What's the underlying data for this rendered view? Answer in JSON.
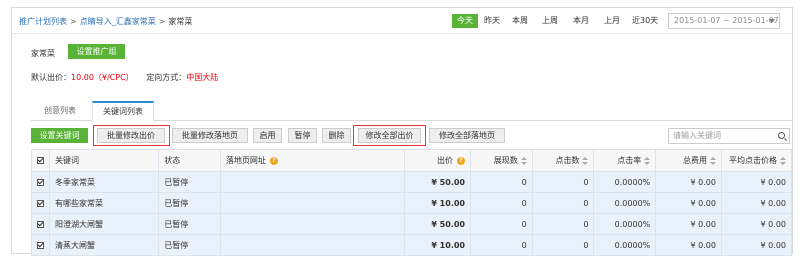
{
  "breadcrumb": {
    "items": [
      "推广计划列表",
      "点睛导入_汇鑫家常菜",
      "家常菜"
    ],
    "separator": ">"
  },
  "date_ranges": [
    "今天",
    "昨天",
    "本周",
    "上周",
    "本月",
    "上月",
    "近30天"
  ],
  "date_range_active": "今天",
  "date_picker": {
    "value": "2015-01-07 ~ 2015-01-07"
  },
  "group": {
    "name": "家常菜",
    "settings_button": "设置推广组"
  },
  "bid": {
    "label": "默认出价：",
    "value": "10.00（¥/CPC）",
    "targeting_label": "定向方式：",
    "targeting_value": "中国大陆"
  },
  "tabs": [
    {
      "label": "创意列表",
      "active": false
    },
    {
      "label": "关键词列表",
      "active": true
    }
  ],
  "toolbar": {
    "set_keywords": "设置关键词",
    "batch_bid": "批量修改出价",
    "batch_landing": "批量修改落地页",
    "enable": "启用",
    "pause": "暂停",
    "delete": "删除",
    "edit_all_bids": "修改全部出价",
    "edit_all_landing": "修改全部落地页"
  },
  "search": {
    "placeholder": "请输入关键词"
  },
  "table": {
    "headers": [
      "关键词",
      "状态",
      "落地页网址",
      "出价",
      "展现数",
      "点击数",
      "点击率",
      "总费用",
      "平均点击价格"
    ],
    "rows": [
      {
        "keyword": "冬季家常菜",
        "status": "已暂停",
        "url": "",
        "bid": "¥ 50.00",
        "impressions": "0",
        "clicks": "0",
        "ctr": "0.0000%",
        "cost": "¥ 0.00",
        "avg_cpc": "¥ 0.00"
      },
      {
        "keyword": "有哪些家常菜",
        "status": "已暂停",
        "url": "",
        "bid": "¥ 10.00",
        "impressions": "0",
        "clicks": "0",
        "ctr": "0.0000%",
        "cost": "¥ 0.00",
        "avg_cpc": "¥ 0.00"
      },
      {
        "keyword": "阳澄湖大闸蟹",
        "status": "已暂停",
        "url": "",
        "bid": "¥ 50.00",
        "impressions": "0",
        "clicks": "0",
        "ctr": "0.0000%",
        "cost": "¥ 0.00",
        "avg_cpc": "¥ 0.00"
      },
      {
        "keyword": "清蒸大闸蟹",
        "status": "已暂停",
        "url": "",
        "bid": "¥ 10.00",
        "impressions": "0",
        "clicks": "0",
        "ctr": "0.0000%",
        "cost": "¥ 0.00",
        "avg_cpc": "¥ 0.00"
      }
    ]
  },
  "colors": {
    "accent_green": "#58b336",
    "link_blue": "#2a6db3",
    "highlight_red": "#e4393c",
    "row_bg": "#e9f1fa"
  }
}
